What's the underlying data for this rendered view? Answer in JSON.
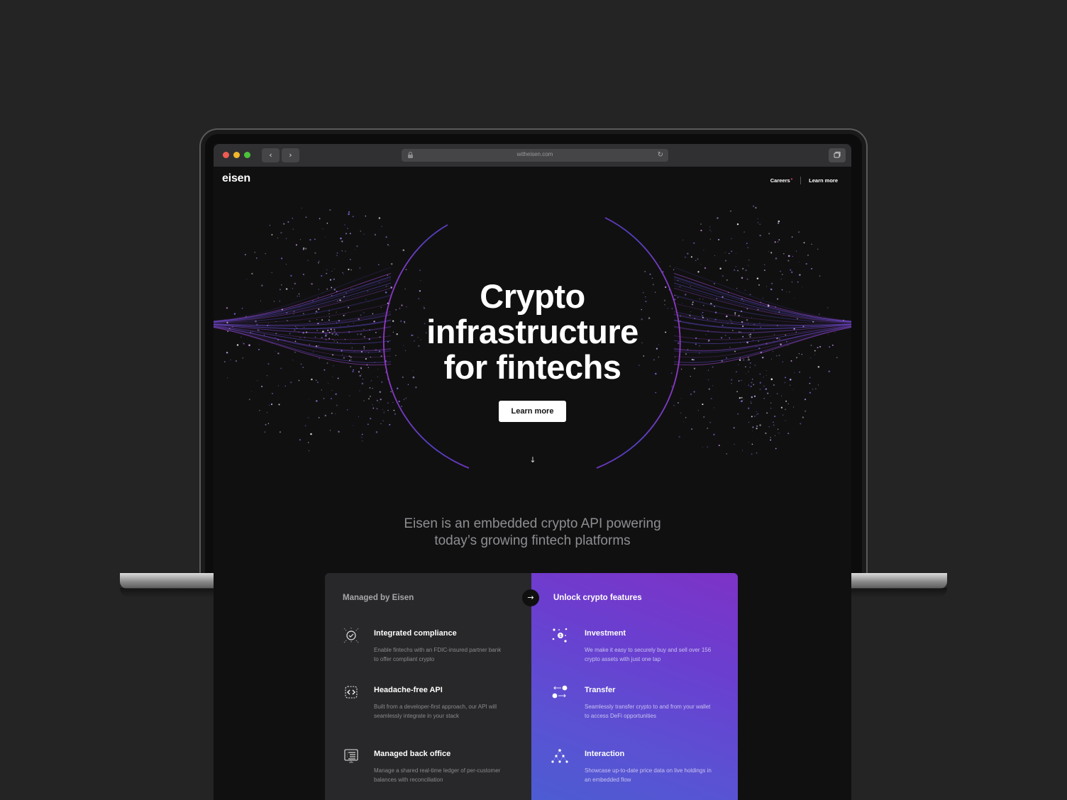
{
  "browser": {
    "url": "witheisen.com",
    "icons": {
      "back": "chevron-left-icon",
      "forward": "chevron-right-icon",
      "lock": "lock-icon",
      "reload": "reload-icon",
      "tabs": "tabs-icon"
    }
  },
  "header": {
    "logo": "eisen",
    "nav": [
      {
        "label": "Careers",
        "badge": "•"
      },
      {
        "label": "Learn more"
      }
    ]
  },
  "hero": {
    "title_lines": [
      "Crypto",
      "infrastructure",
      "for fintechs"
    ],
    "cta_label": "Learn more",
    "scroll_icon": "arrow-down-icon"
  },
  "intro": {
    "lines": [
      "Eisen is an embedded crypto API powering",
      "today’s growing fintech platforms"
    ]
  },
  "managed": {
    "heading": "Managed by Eisen",
    "items": [
      {
        "icon": "compliance-icon",
        "title": "Integrated compliance",
        "desc": "Enable fintechs with an FDIC-insured partner bank to offer compliant crypto"
      },
      {
        "icon": "api-icon",
        "title": "Headache-free  API",
        "desc": "Built from a developer-first approach, our API will seamlessly integrate in your stack"
      },
      {
        "icon": "ledger-icon",
        "title": "Managed back office",
        "desc": "Manage a shared real-time ledger of per-customer balances with reconciliation"
      }
    ]
  },
  "unlock": {
    "heading": "Unlock crypto features",
    "items": [
      {
        "icon": "investment-icon",
        "title": "Investment",
        "desc": "We make it easy to securely buy and sell over 156 crypto assets with just one tap"
      },
      {
        "icon": "transfer-icon",
        "title": "Transfer",
        "desc": "Seamlessly transfer crypto to and from your wallet to access DeFi opportunities"
      },
      {
        "icon": "interaction-icon",
        "title": "Interaction",
        "desc": "Showcase up-to-date price data on live holdings in an embedded flow"
      }
    ]
  },
  "colors": {
    "background": "#242424",
    "site_bg": "#101011",
    "accent_purple": "#7d33c6",
    "accent_blue": "#4b5dd2",
    "badge_red": "#e8455d"
  }
}
